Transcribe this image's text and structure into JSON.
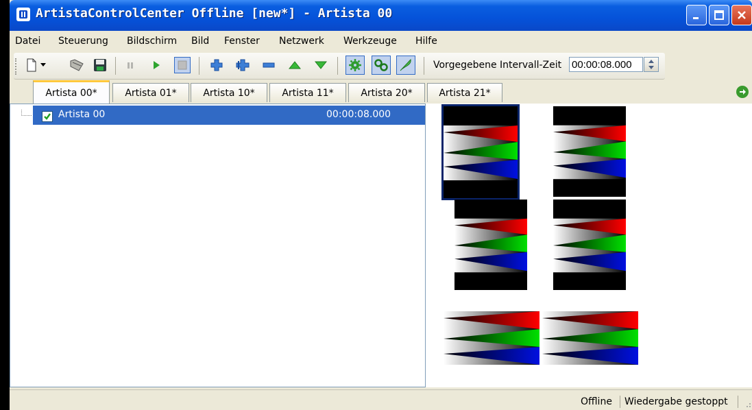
{
  "window": {
    "title": "ArtistaControlCenter Offline [new*] - Artista 00"
  },
  "menu": [
    "Datei",
    "Steuerung",
    "Bildschirm",
    "Bild",
    "Fenster",
    "Netzwerk",
    "Werkzeuge",
    "Hilfe"
  ],
  "toolbar": {
    "interval_label": "Vorgegebene Intervall-Zeit",
    "interval_value": "00:00:08.000"
  },
  "tabs": [
    "Artista 00*",
    "Artista 01*",
    "Artista 10*",
    "Artista 11*",
    "Artista 20*",
    "Artista 21*"
  ],
  "tree": {
    "items": [
      {
        "name": "Artista 00",
        "time": "00:00:08.000",
        "checked": true
      }
    ]
  },
  "status": {
    "connection": "Offline",
    "playback": "Wiedergabe gestoppt"
  },
  "colors": {
    "title_bar": "#0a5ee0",
    "selection": "#316ac5",
    "tab_highlight": "#ffc83c"
  }
}
